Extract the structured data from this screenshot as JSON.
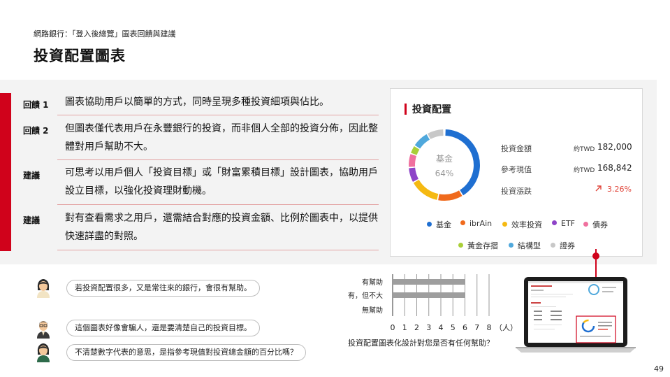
{
  "header": {
    "breadcrumb": "網路銀行：「登入後總覽」圖表回饋與建議",
    "title": "投資配置圖表"
  },
  "feedback": [
    {
      "tag": "回饋 1",
      "text": "圖表協助用戶以簡單的方式，同時呈現多種投資細項與佔比。"
    },
    {
      "tag": "回饋 2",
      "text": "但圖表僅代表用戶在永豐銀行的投資，而非個人全部的投資分佈，因此整體對用戶幫助不大。"
    },
    {
      "tag": "建議",
      "text": "可思考以用戶個人「投資目標」或「財富累積目標」設計圖表，協助用戶設立目標，以強化投資理財動機。"
    },
    {
      "tag": "建議",
      "text": "對有查看需求之用戶，還需結合對應的投資金額、比例於圖表中，以提供快速詳盡的對照。"
    }
  ],
  "card": {
    "title": "投資配置",
    "center_label": "基金",
    "center_percent": "64%",
    "stats": [
      {
        "label": "投資金額",
        "prefix": "約TWD",
        "value": "182,000"
      },
      {
        "label": "參考現值",
        "prefix": "約TWD",
        "value": "168,842"
      },
      {
        "label": "投資漲跌",
        "value": "3.26%"
      }
    ],
    "legend_row1": [
      {
        "name": "基金",
        "color": "#1f6fd1"
      },
      {
        "name": "ibrAin",
        "color": "#f06a1c"
      },
      {
        "name": "效率投資",
        "color": "#f5b912"
      },
      {
        "name": "ETF",
        "color": "#8e44c8"
      },
      {
        "name": "債券",
        "color": "#f0709e"
      }
    ],
    "legend_row2": [
      {
        "name": "黃金存摺",
        "color": "#a9cf38"
      },
      {
        "name": "結構型",
        "color": "#4fa8dc"
      },
      {
        "name": "證券",
        "color": "#c8c8c8"
      }
    ],
    "trend_icon": "arrow-up-right-icon"
  },
  "comments": [
    {
      "avatar": "female-user-icon",
      "text": "若投資配置很多，又是常往來的銀行，會很有幫助。"
    },
    {
      "avatar": "male-user-icon",
      "text": "這個圖表好像會騙人，還是要清楚自己的投資目標。"
    },
    {
      "avatar": "female-user-icon",
      "text": "不清楚數字代表的意思，是指參考現值對投資總金額的百分比嗎？"
    }
  ],
  "chart_data": {
    "type": "bar",
    "orientation": "horizontal",
    "categories": [
      "有幫助",
      "有，但不大",
      "無幫助"
    ],
    "values": [
      6,
      6,
      0
    ],
    "xlim": [
      0,
      8
    ],
    "x_ticks": [
      "0",
      "1",
      "2",
      "3",
      "4",
      "5",
      "6",
      "7",
      "8"
    ],
    "x_unit": "（人）",
    "grid": true,
    "bar_color": "#9e9e9e",
    "caption": "投資配置圖表化設計對您是否有任何幫助？"
  },
  "page_number": "49",
  "colors": {
    "accent": "#d0021b",
    "panel": "#f3f3f3",
    "bar": "#9e9e9e"
  }
}
